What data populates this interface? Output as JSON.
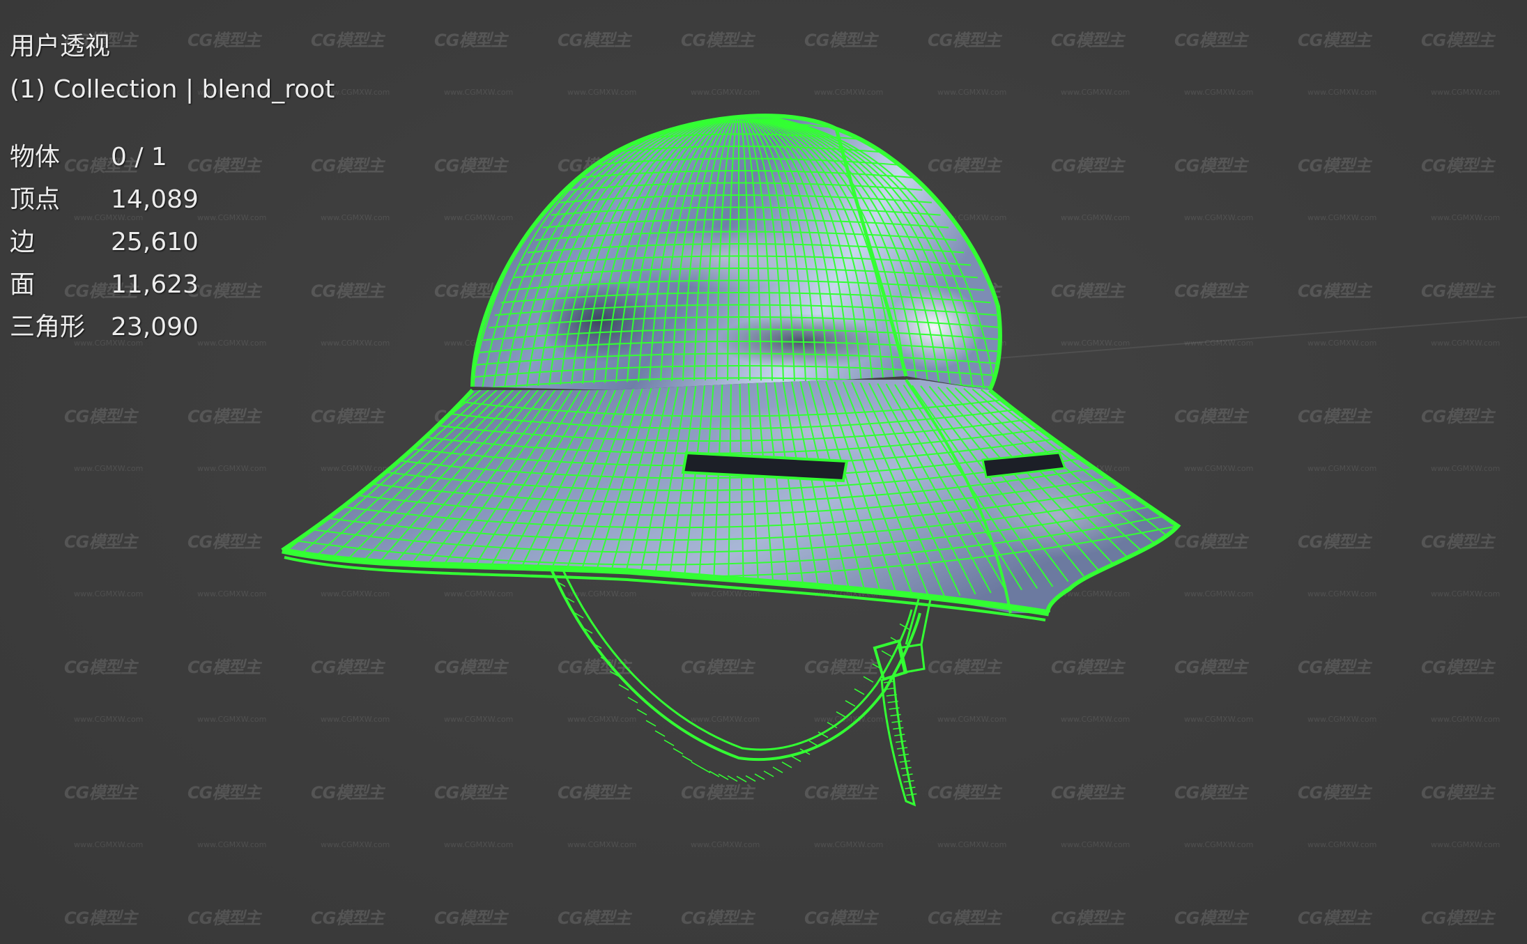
{
  "viewport": {
    "view_name": "用户透视",
    "collection_line": "(1) Collection | blend_root",
    "stats": [
      {
        "label": "物体",
        "value": "0 / 1"
      },
      {
        "label": "顶点",
        "value": "14,089"
      },
      {
        "label": "边",
        "value": "25,610"
      },
      {
        "label": "面",
        "value": "11,623"
      },
      {
        "label": "三角形",
        "value": "23,090"
      }
    ]
  },
  "watermark": {
    "logo_text": "CG模型主",
    "url_text": "www.CGMXW.com"
  },
  "colors": {
    "background": "#3d3d3d",
    "wireframe": "#33ff33",
    "text": "#ececec"
  }
}
